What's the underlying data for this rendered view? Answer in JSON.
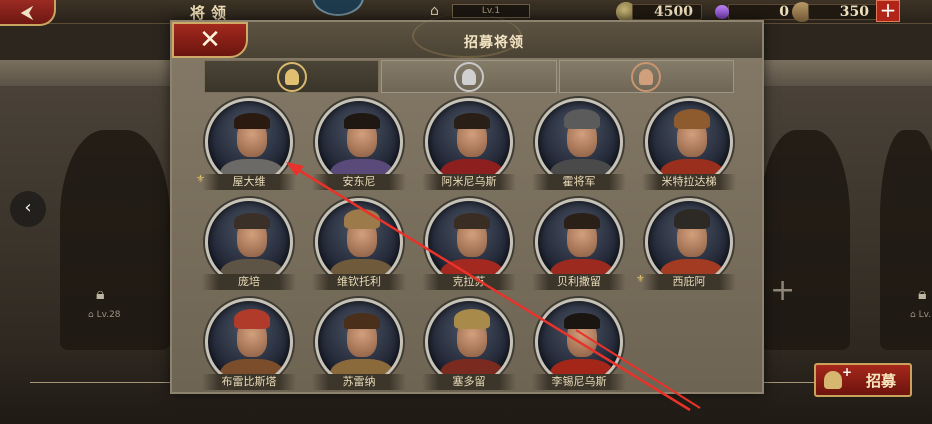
{
  "top_bar": {
    "back_label": "⮜",
    "title": "将领",
    "level_label": "Lv.1",
    "resources": [
      {
        "name": "coins",
        "value": "4500",
        "color": "#b5a566"
      },
      {
        "name": "gems",
        "value": "0",
        "color": "#9b59d8"
      },
      {
        "name": "supplies",
        "value": "350",
        "color": "#b0925e"
      }
    ],
    "plus_label": "+"
  },
  "background": {
    "nav_left_label": "‹",
    "slot_left_level": "Lv.28",
    "slot_right_level": "Lv.",
    "add_slot_label": "+",
    "recruit_button_label": "招募",
    "recruit_sparkle": "+"
  },
  "modal": {
    "close_label": "✕",
    "title": "招募将领",
    "tabs": [
      {
        "name": "gold",
        "active": true
      },
      {
        "name": "silver",
        "active": false
      },
      {
        "name": "bronze",
        "active": false
      }
    ],
    "heroes": [
      {
        "name": "屋大维",
        "badge": true,
        "hair": "#2b1a10",
        "clothes": "#6b6a66",
        "helmet": false
      },
      {
        "name": "安东尼",
        "badge": false,
        "hair": "#1f1712",
        "clothes": "#5a4a7a",
        "helmet": false
      },
      {
        "name": "阿米尼乌斯",
        "badge": false,
        "hair": "#2a1f17",
        "clothes": "#8e1f1f",
        "helmet": false
      },
      {
        "name": "霍将军",
        "badge": false,
        "hair": "#5b5b5b",
        "clothes": "#4a4a4a",
        "helmet": true
      },
      {
        "name": "米特拉达梯",
        "badge": false,
        "hair": "#8d5b2d",
        "clothes": "#9a2f1d",
        "helmet": true
      },
      {
        "name": "庞培",
        "badge": false,
        "hair": "#3a3028",
        "clothes": "#5d5445",
        "helmet": false
      },
      {
        "name": "维钦托利",
        "badge": false,
        "hair": "#9c7a4a",
        "clothes": "#6f5a3b",
        "helmet": true
      },
      {
        "name": "克拉苏",
        "badge": false,
        "hair": "#3a2e24",
        "clothes": "#a3281f",
        "helmet": false
      },
      {
        "name": "贝利撒留",
        "badge": false,
        "hair": "#2b2018",
        "clothes": "#9c2a1e",
        "helmet": false
      },
      {
        "name": "西庇阿",
        "badge": true,
        "hair": "#2d2a26",
        "clothes": "#a33a22",
        "helmet": true
      },
      {
        "name": "布雷比斯塔",
        "badge": false,
        "hair": "#b13b2a",
        "clothes": "#7b4d2a",
        "helmet": true
      },
      {
        "name": "苏雷纳",
        "badge": false,
        "hair": "#4a2f1a",
        "clothes": "#8a6a3a",
        "helmet": false
      },
      {
        "name": "塞多留",
        "badge": false,
        "hair": "#a88a4a",
        "clothes": "#7a2a1e",
        "helmet": true
      },
      {
        "name": "李锡尼乌斯",
        "badge": false,
        "hair": "#1b1512",
        "clothes": "#a42618",
        "helmet": false
      }
    ]
  },
  "annotation": {
    "color": "#e8322a"
  }
}
